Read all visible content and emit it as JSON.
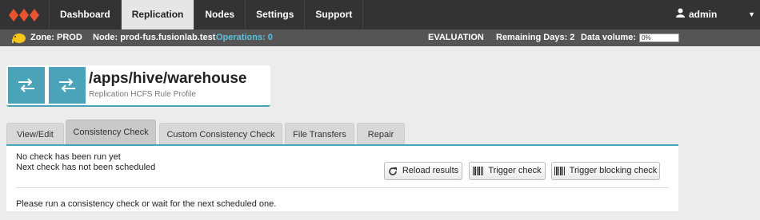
{
  "nav": {
    "items": [
      {
        "label": "Dashboard"
      },
      {
        "label": "Replication"
      },
      {
        "label": "Nodes"
      },
      {
        "label": "Settings"
      },
      {
        "label": "Support"
      }
    ],
    "active": "Replication",
    "user": "admin"
  },
  "status": {
    "zone": "Zone: PROD",
    "node": "Node: prod-fus.fusionlab.test",
    "operations": "Operations: 0",
    "evaluation": "EVALUATION",
    "remaining_days": "Remaining Days: 2",
    "data_volume_label": "Data volume:",
    "data_volume_value": "0%"
  },
  "header": {
    "title": "/apps/hive/warehouse",
    "subtitle": "Replication HCFS Rule Profile"
  },
  "tabs": [
    {
      "label": "View/Edit"
    },
    {
      "label": "Consistency Check"
    },
    {
      "label": "Custom Consistency Check"
    },
    {
      "label": "File Transfers"
    },
    {
      "label": "Repair"
    }
  ],
  "active_tab": "Consistency Check",
  "panel": {
    "line1": "No check has been run yet",
    "line2": "Next check has not been scheduled",
    "reload": "Reload results",
    "trigger": "Trigger check",
    "trigger_blocking": "Trigger blocking check",
    "message": "Please run a consistency check or wait for the next scheduled one."
  },
  "colors": {
    "accent": "#4aa3b8",
    "logo": "#e8542f",
    "nav_bg": "#333333",
    "status_bg": "#555555",
    "operations": "#5bc0de"
  }
}
